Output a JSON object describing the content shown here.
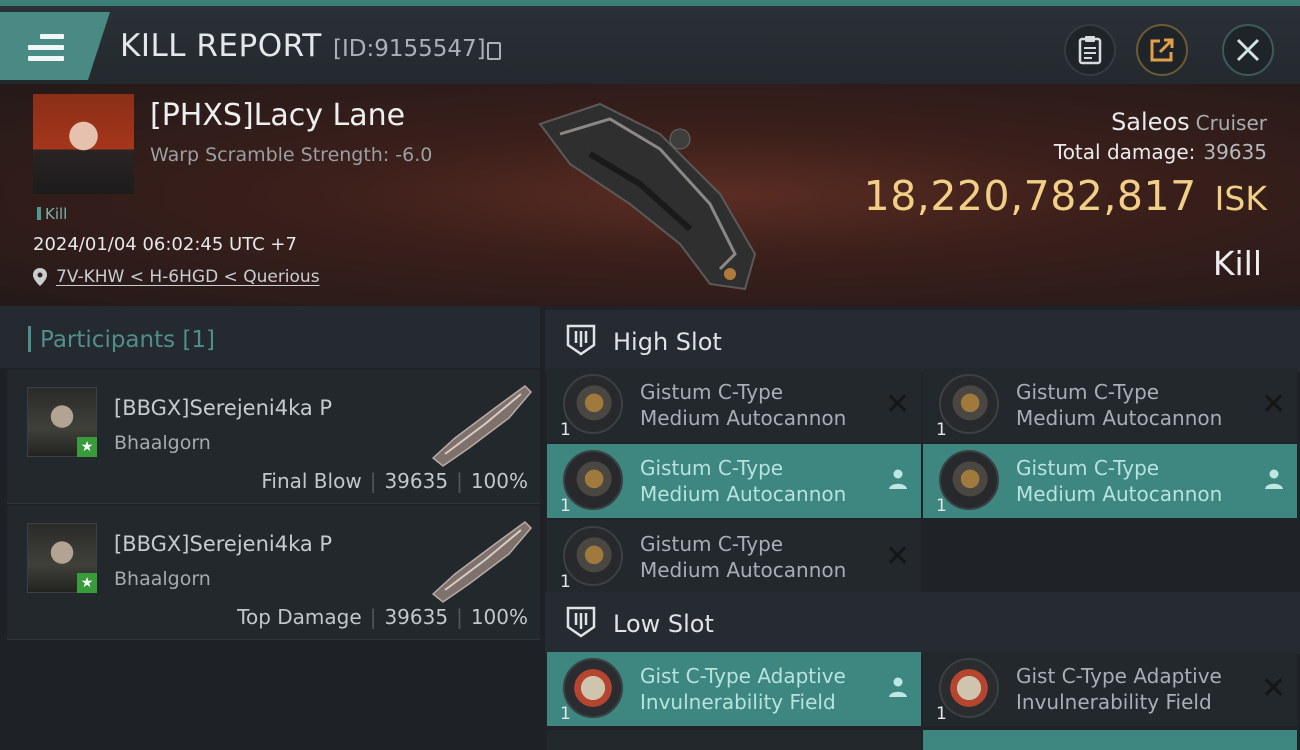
{
  "header": {
    "title": "KILL REPORT",
    "report_id": "[ID:9155547]"
  },
  "victim": {
    "name": "[PHXS]Lacy Lane",
    "scramble": "Warp Scramble Strength: -6.0",
    "tag": "Kill",
    "datetime": "2024/01/04 06:02:45 UTC +7",
    "location": "7V-KHW < H-6HGD < Querious",
    "ship": "Saleos",
    "ship_class": "Cruiser",
    "damage_label": "Total damage:",
    "damage_value": "39635",
    "isk_value": "18,220,782,817",
    "isk_unit": "ISK",
    "result": "Kill"
  },
  "participants": {
    "title": "Participants [1]",
    "rows": [
      {
        "name": "[BBGX]Serejeni4ka P",
        "ship": "Bhaalgorn",
        "role": "Final Blow",
        "damage": "39635",
        "percent": "100%"
      },
      {
        "name": "[BBGX]Serejeni4ka P",
        "ship": "Bhaalgorn",
        "role": "Top Damage",
        "damage": "39635",
        "percent": "100%"
      }
    ]
  },
  "slots": {
    "high_title": "High Slot",
    "low_title": "Low Slot",
    "high": [
      {
        "line1": "Gistum C-Type",
        "line2": "Medium Autocannon",
        "qty": "1",
        "status": "destroyed"
      },
      {
        "line1": "Gistum C-Type",
        "line2": "Medium Autocannon",
        "qty": "1",
        "status": "destroyed"
      },
      {
        "line1": "Gistum C-Type",
        "line2": "Medium Autocannon",
        "qty": "1",
        "status": "dropped"
      },
      {
        "line1": "Gistum C-Type",
        "line2": "Medium Autocannon",
        "qty": "1",
        "status": "dropped"
      },
      {
        "line1": "Gistum C-Type",
        "line2": "Medium Autocannon",
        "qty": "1",
        "status": "destroyed"
      }
    ],
    "low": [
      {
        "line1": "Gist C-Type Adaptive",
        "line2": "Invulnerability Field",
        "qty": "1",
        "status": "dropped"
      },
      {
        "line1": "Gist C-Type Adaptive",
        "line2": "Invulnerability Field",
        "qty": "1",
        "status": "destroyed"
      }
    ]
  },
  "colors": {
    "accent": "#3e8680",
    "isk_gold": "#f2cf86"
  }
}
